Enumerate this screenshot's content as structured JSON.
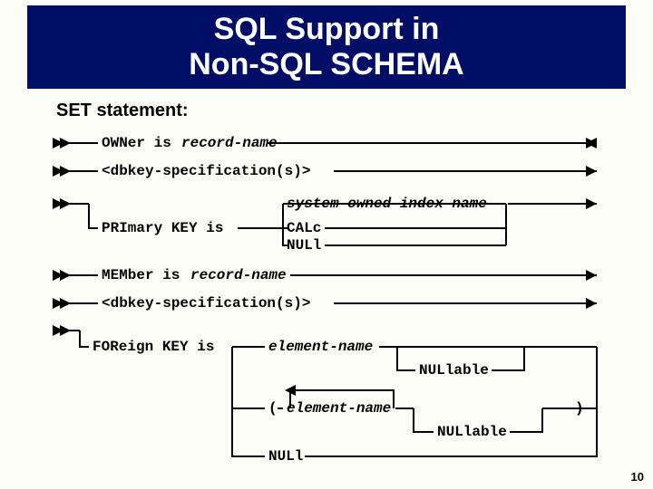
{
  "title_line1": "SQL Support in",
  "title_line2": "Non-SQL SCHEMA",
  "subtitle": "SET statement:",
  "owner": "OWNer is ",
  "record_name": "record-name",
  "dbkey_spec": "<dbkey-specification(s)>",
  "primary_key": "PRImary KEY is",
  "sys_owned_idx": "system-owned-index-name",
  "calc": "CALc",
  "null_kw": "NULl",
  "member": "MEMber is ",
  "foreign_key": "FOReign KEY is",
  "element_name": "element-name",
  "nullable": "NULlable",
  "paren_open": "(",
  "paren_close": ")",
  "page_number": "10"
}
